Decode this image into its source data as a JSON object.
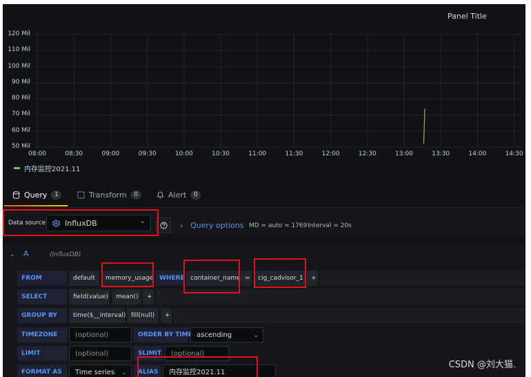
{
  "panel": {
    "title": "Panel Title"
  },
  "colors": {
    "series": "#73bf69",
    "accent": "#5794f2",
    "highlight": "#e5121b"
  },
  "chart_data": {
    "type": "line",
    "title": "Panel Title",
    "ylim": [
      50,
      120
    ],
    "y_ticks": [
      "120 Mil",
      "110 Mil",
      "100 Mil",
      "90 Mil",
      "80 Mil",
      "70 Mil",
      "60 Mil",
      "50 Mil"
    ],
    "x_ticks": [
      "08:00",
      "08:30",
      "09:00",
      "09:30",
      "10:00",
      "10:30",
      "11:00",
      "11:30",
      "12:00",
      "12:30",
      "13:00",
      "13:30",
      "14:00",
      "14:30"
    ],
    "grid": true,
    "legend_position": "bottom-left",
    "series": [
      {
        "name": "内存监控2021.11",
        "points": [
          {
            "x": "13:16",
            "y": 52
          },
          {
            "x": "13:17",
            "y": 74
          }
        ]
      }
    ]
  },
  "tabs": [
    {
      "label": "Query",
      "count": "1",
      "icon": "database-icon"
    },
    {
      "label": "Transform",
      "count": "0",
      "icon": "transform-icon"
    },
    {
      "label": "Alert",
      "count": "0",
      "icon": "bell-icon"
    }
  ],
  "datasource": {
    "label": "Data source",
    "value": "InfluxDB"
  },
  "query_options": {
    "label": "Query options",
    "md": "MD = auto = 1769",
    "interval": "Interval = 20s"
  },
  "query": {
    "ref_id": "A",
    "ref_db": "(InfluxDB)",
    "from": {
      "keyword": "FROM",
      "policy": "default",
      "measurement": "memory_usage",
      "where_kw": "WHERE",
      "tag_key": "container_name",
      "operator": "=",
      "tag_value": "cig_cadvisor_1",
      "add": "+"
    },
    "select": {
      "keyword": "SELECT",
      "field": "field(value)",
      "agg": "mean()",
      "add": "+"
    },
    "group_by": {
      "keyword": "GROUP BY",
      "time": "time($__interval)",
      "fill": "fill(null)",
      "add": "+"
    },
    "timezone": {
      "keyword": "TIMEZONE",
      "placeholder": "(optional)",
      "order_kw": "ORDER BY TIME",
      "order_value": "ascending"
    },
    "limit": {
      "keyword": "LIMIT",
      "placeholder": "(optional)",
      "slimit_kw": "SLIMIT",
      "slimit_placeholder": "(optional)"
    },
    "format": {
      "keyword": "FORMAT AS",
      "value": "Time series",
      "alias_kw": "ALIAS",
      "alias_value": "内存监控2021.11"
    }
  },
  "watermark": "CSDN @刘大猫."
}
